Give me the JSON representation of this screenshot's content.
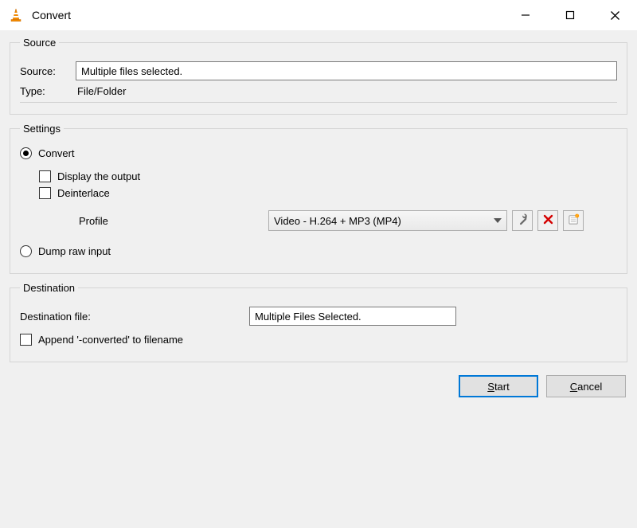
{
  "window": {
    "title": "Convert"
  },
  "source": {
    "legend": "Source",
    "source_label": "Source:",
    "source_value": "Multiple files selected.",
    "type_label": "Type:",
    "type_value": "File/Folder"
  },
  "settings": {
    "legend": "Settings",
    "convert_label": "Convert",
    "display_output_label": "Display the output",
    "deinterlace_label": "Deinterlace",
    "profile_label": "Profile",
    "profile_value": "Video - H.264 + MP3 (MP4)",
    "dump_label": "Dump raw input"
  },
  "destination": {
    "legend": "Destination",
    "file_label": "Destination file:",
    "file_value": "Multiple Files Selected.",
    "append_label": "Append '-converted' to filename"
  },
  "footer": {
    "start": "Start",
    "cancel": "Cancel"
  },
  "icons": {
    "wrench": "wrench-icon",
    "delete": "delete-icon",
    "new_profile": "new-profile-icon"
  }
}
